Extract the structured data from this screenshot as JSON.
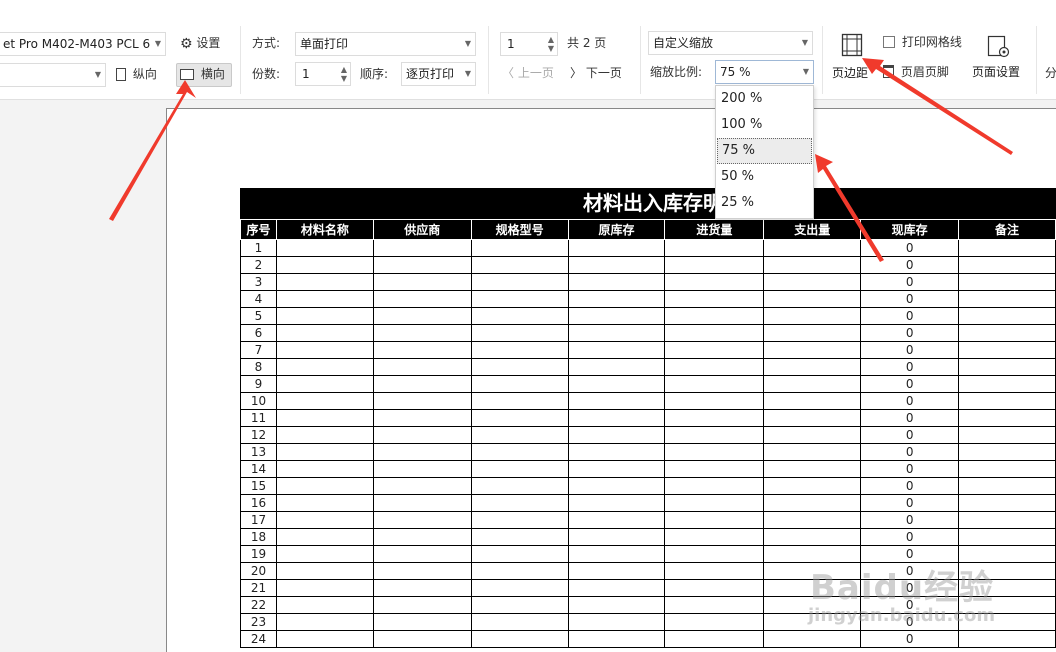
{
  "printer": {
    "selected": "et Pro M402-M403 PCL 6"
  },
  "paper_select": {
    "value": ""
  },
  "buttons": {
    "settings": "设置",
    "portrait": "纵向",
    "landscape": "横向",
    "prev_page": "上一页",
    "next_page": "下一页",
    "margins": "页边距",
    "header_footer": "页眉页脚",
    "page_setup": "页面设置",
    "split": "分"
  },
  "print_options": {
    "mode_label": "方式:",
    "mode_value": "单面打印",
    "copies_label": "份数:",
    "copies_value": "1",
    "order_label": "顺序:",
    "order_value": "逐页打印"
  },
  "pagination": {
    "current_page": "1",
    "total": "共 2 页"
  },
  "zoom": {
    "mode_value": "自定义缩放",
    "ratio_label": "缩放比例:",
    "ratio_value": "75 %",
    "options": [
      "200 %",
      "100 %",
      "75 %",
      "50 %",
      "25 %"
    ],
    "selected_index": 2
  },
  "print_gridlines": {
    "label": "打印网格线",
    "checked": false
  },
  "sheet": {
    "title": "材料出入库存明细",
    "columns": [
      "序号",
      "材料名称",
      "供应商",
      "规格型号",
      "原库存",
      "进货量",
      "支出量",
      "现库存",
      "备注"
    ],
    "rows": [
      [
        "1",
        "",
        "",
        "",
        "",
        "",
        "",
        "0",
        ""
      ],
      [
        "2",
        "",
        "",
        "",
        "",
        "",
        "",
        "0",
        ""
      ],
      [
        "3",
        "",
        "",
        "",
        "",
        "",
        "",
        "0",
        ""
      ],
      [
        "4",
        "",
        "",
        "",
        "",
        "",
        "",
        "0",
        ""
      ],
      [
        "5",
        "",
        "",
        "",
        "",
        "",
        "",
        "0",
        ""
      ],
      [
        "6",
        "",
        "",
        "",
        "",
        "",
        "",
        "0",
        ""
      ],
      [
        "7",
        "",
        "",
        "",
        "",
        "",
        "",
        "0",
        ""
      ],
      [
        "8",
        "",
        "",
        "",
        "",
        "",
        "",
        "0",
        ""
      ],
      [
        "9",
        "",
        "",
        "",
        "",
        "",
        "",
        "0",
        ""
      ],
      [
        "10",
        "",
        "",
        "",
        "",
        "",
        "",
        "0",
        ""
      ],
      [
        "11",
        "",
        "",
        "",
        "",
        "",
        "",
        "0",
        ""
      ],
      [
        "12",
        "",
        "",
        "",
        "",
        "",
        "",
        "0",
        ""
      ],
      [
        "13",
        "",
        "",
        "",
        "",
        "",
        "",
        "0",
        ""
      ],
      [
        "14",
        "",
        "",
        "",
        "",
        "",
        "",
        "0",
        ""
      ],
      [
        "15",
        "",
        "",
        "",
        "",
        "",
        "",
        "0",
        ""
      ],
      [
        "16",
        "",
        "",
        "",
        "",
        "",
        "",
        "0",
        ""
      ],
      [
        "17",
        "",
        "",
        "",
        "",
        "",
        "",
        "0",
        ""
      ],
      [
        "18",
        "",
        "",
        "",
        "",
        "",
        "",
        "0",
        ""
      ],
      [
        "19",
        "",
        "",
        "",
        "",
        "",
        "",
        "0",
        ""
      ],
      [
        "20",
        "",
        "",
        "",
        "",
        "",
        "",
        "0",
        ""
      ],
      [
        "21",
        "",
        "",
        "",
        "",
        "",
        "",
        "0",
        ""
      ],
      [
        "22",
        "",
        "",
        "",
        "",
        "",
        "",
        "0",
        ""
      ],
      [
        "23",
        "",
        "",
        "",
        "",
        "",
        "",
        "0",
        ""
      ],
      [
        "24",
        "",
        "",
        "",
        "",
        "",
        "",
        "0",
        ""
      ]
    ]
  },
  "watermark": {
    "brand": "Baidu经验",
    "url": "jingyan.baidu.com"
  },
  "colors": {
    "annotation_arrow": "#f03a2c",
    "header_bg": "#000000",
    "dropdown_selected": "#ececec"
  }
}
